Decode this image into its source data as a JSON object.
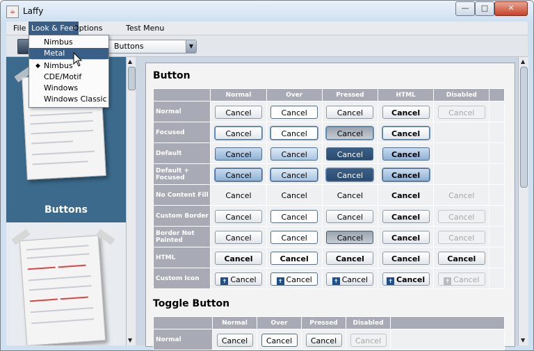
{
  "window": {
    "title": "Laffy",
    "app_icon": "java-cup-icon",
    "min_label": "—",
    "max_label": "□",
    "close_label": "✕"
  },
  "menubar": [
    "File",
    "Look & Feel",
    "Options",
    "Test Menu"
  ],
  "menu_active": "Look & Feel",
  "lf_menu": {
    "items": [
      "Nimbus",
      "Metal",
      "Nimbus",
      "CDE/Motif",
      "Windows",
      "Windows Classic"
    ],
    "highlighted": "Metal",
    "checked_mark": "◆"
  },
  "toolbar": {
    "icon": "save-icon",
    "combo_value": "Buttons",
    "combo_arrow": "▼"
  },
  "sidebar": {
    "items": [
      {
        "label": "Buttons",
        "selected": true
      },
      {
        "label": "",
        "selected": false
      }
    ]
  },
  "button_section": {
    "title": "Button",
    "columns": [
      "",
      "Normal",
      "Over",
      "Pressed",
      "HTML",
      "Disabled"
    ],
    "rows": [
      {
        "label": "Normal",
        "cells": [
          "Cancel",
          "Cancel",
          "Cancel",
          "Cancel",
          "Cancel"
        ]
      },
      {
        "label": "Focused",
        "cells": [
          "Cancel",
          "Cancel",
          "Cancel",
          "Cancel",
          ""
        ]
      },
      {
        "label": "Default",
        "cells": [
          "Cancel",
          "Cancel",
          "Cancel",
          "Cancel",
          ""
        ]
      },
      {
        "label": "Default + Focused",
        "cells": [
          "Cancel",
          "Cancel",
          "Cancel",
          "Cancel",
          ""
        ]
      },
      {
        "label": "No Content Fill",
        "cells": [
          "Cancel",
          "Cancel",
          "Cancel",
          "Cancel",
          "Cancel"
        ]
      },
      {
        "label": "Custom Border",
        "cells": [
          "Cancel",
          "Cancel",
          "Cancel",
          "Cancel",
          "Cancel"
        ]
      },
      {
        "label": "Border Not Painted",
        "cells": [
          "Cancel",
          "Cancel",
          "Cancel",
          "Cancel",
          "Cancel"
        ]
      },
      {
        "label": "HTML",
        "cells": [
          "Cancel",
          "Cancel",
          "Cancel",
          "Cancel",
          "Cancel"
        ]
      },
      {
        "label": "Custom Icon",
        "cells": [
          "Cancel",
          "Cancel",
          "Cancel",
          "Cancel",
          "Cancel"
        ]
      }
    ]
  },
  "toggle_section": {
    "title": "Toggle Button",
    "columns": [
      "",
      "Normal",
      "Over",
      "Pressed",
      "Disabled"
    ],
    "rows": [
      {
        "label": "Normal",
        "cells": [
          "Cancel",
          "Cancel",
          "Cancel",
          "Cancel"
        ]
      }
    ]
  },
  "scroll": {
    "up": "▲",
    "down": "▼",
    "left": "◀",
    "right": "▶"
  }
}
